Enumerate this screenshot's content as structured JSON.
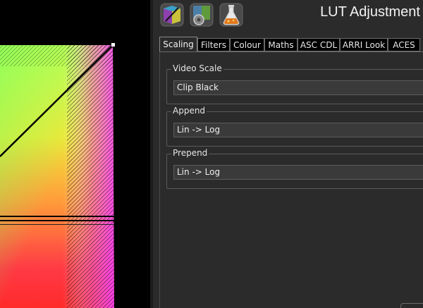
{
  "window": {
    "title": "LUT Adjustment"
  },
  "toolbar": {
    "buttons": [
      {
        "icon": "color-cube-icon"
      },
      {
        "icon": "color-gear-icon"
      },
      {
        "icon": "flask-icon"
      }
    ]
  },
  "tabs": [
    {
      "label": "Scaling",
      "active": true
    },
    {
      "label": "Filters",
      "active": false
    },
    {
      "label": "Colour",
      "active": false
    },
    {
      "label": "Maths",
      "active": false
    },
    {
      "label": "ASC CDL",
      "active": false
    },
    {
      "label": "ARRI Look",
      "active": false
    },
    {
      "label": "ACES",
      "active": false
    }
  ],
  "groups": {
    "video_scale": {
      "label": "Video Scale",
      "value": "Clip Black"
    },
    "append": {
      "label": "Append",
      "value": "Lin -> Log"
    },
    "prepend": {
      "label": "Prepend",
      "value": "Lin -> Log"
    }
  },
  "colors": {
    "panel_bg": "#2b2b2b",
    "field_bg": "#3a3a3a",
    "border": "#5a5a5a",
    "text": "#e6e6e6"
  }
}
